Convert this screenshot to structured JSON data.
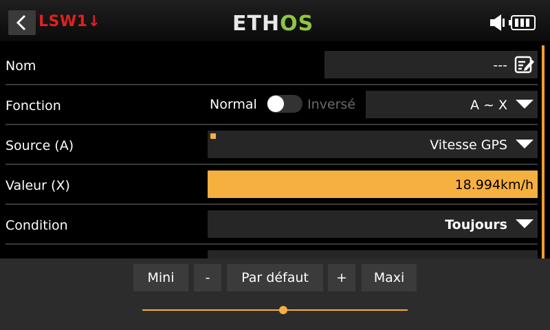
{
  "header": {
    "switch_name": "LSW1↓",
    "logo_left": "ETH",
    "logo_right": "OS"
  },
  "rows": {
    "name": {
      "label": "Nom",
      "value": "---"
    },
    "function": {
      "label": "Fonction",
      "normal": "Normal",
      "inverse": "Inversé",
      "value": "A ~ X"
    },
    "source": {
      "label": "Source (A)",
      "value": "Vitesse GPS"
    },
    "value": {
      "label": "Valeur (X)",
      "value": "18.994km/h"
    },
    "condition": {
      "label": "Condition",
      "value": "Toujours"
    }
  },
  "bottom": {
    "mini": "Mini",
    "minus": "-",
    "default": "Par défaut",
    "plus": "+",
    "maxi": "Maxi",
    "slider_fraction": 0.53
  },
  "colors": {
    "accent": "#f5b040",
    "switch_red": "#e02020",
    "logo_green": "#8dc63f"
  },
  "icons": [
    "back-arrow-icon",
    "speaker-icon",
    "battery-icon",
    "edit-icon",
    "dropdown-icon"
  ]
}
